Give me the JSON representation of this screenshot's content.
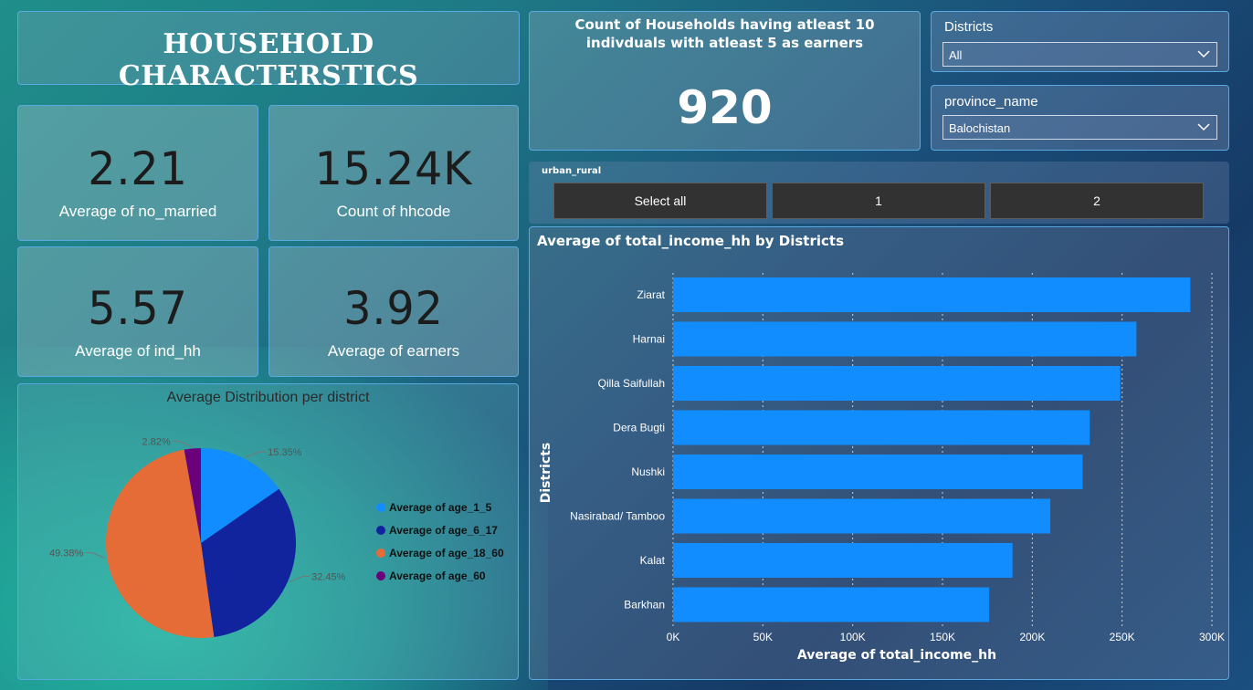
{
  "header": {
    "title": "HOUSEHOLD CHARACTERSTICS"
  },
  "kpis": [
    {
      "value": "2.21",
      "label": "Average of no_married"
    },
    {
      "value": "15.24K",
      "label": "Count of hhcode"
    },
    {
      "value": "5.57",
      "label": "Average of ind_hh"
    },
    {
      "value": "3.92",
      "label": "Average of earners"
    }
  ],
  "count_card": {
    "title": "Count of Households having atleast 10 indivduals with atleast 5 as earners",
    "value": "920"
  },
  "slicers": {
    "districts": {
      "title": "Districts",
      "selected": "All"
    },
    "province": {
      "title": "province_name",
      "selected": "Balochistan"
    }
  },
  "urban_rural": {
    "title": "urban_rural",
    "buttons": [
      "Select all",
      "1",
      "2"
    ]
  },
  "chart_data": [
    {
      "type": "pie",
      "title": "Average Distribution per district",
      "labels": [
        "Average of age_1_5",
        "Average of age_6_17",
        "Average of age_18_60",
        "Average of age_60"
      ],
      "values": [
        15.35,
        32.45,
        49.38,
        2.82
      ],
      "value_labels": [
        "15.35%",
        "32.45%",
        "49.38%",
        "2.82%"
      ],
      "colors": [
        "#118dff",
        "#12239e",
        "#e66c37",
        "#6b007b"
      ],
      "legend": "right"
    },
    {
      "type": "bar",
      "orientation": "horizontal",
      "title": "Average of total_income_hh by Districts",
      "xlabel": "Average of total_income_hh",
      "ylabel": "Districts",
      "categories": [
        "Ziarat",
        "Harnai",
        "Qilla Saifullah",
        "Dera Bugti",
        "Nushki",
        "Nasirabad/ Tamboo",
        "Kalat",
        "Barkhan"
      ],
      "values": [
        288000,
        258000,
        249000,
        232000,
        228000,
        210000,
        189000,
        176000
      ],
      "xlim": [
        0,
        300000
      ],
      "ticks": [
        0,
        50000,
        100000,
        150000,
        200000,
        250000,
        300000
      ],
      "tick_labels": [
        "0K",
        "50K",
        "100K",
        "150K",
        "200K",
        "250K",
        "300K"
      ],
      "color": "#118dff",
      "grid": true
    }
  ]
}
